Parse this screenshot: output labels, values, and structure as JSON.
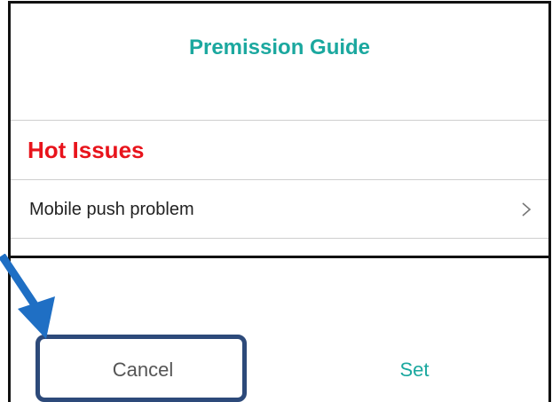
{
  "dialog": {
    "title": "Premission Guide",
    "section_heading": "Hot Issues",
    "items": [
      {
        "label": "Mobile push problem",
        "icon": "chevron-right-icon"
      }
    ],
    "buttons": {
      "cancel_label": "Cancel",
      "set_label": "Set"
    }
  },
  "colors": {
    "accent": "#1ba89f",
    "heading_red": "#e8141c",
    "highlight": "#2d4a7a",
    "arrow": "#1f6fc4"
  }
}
